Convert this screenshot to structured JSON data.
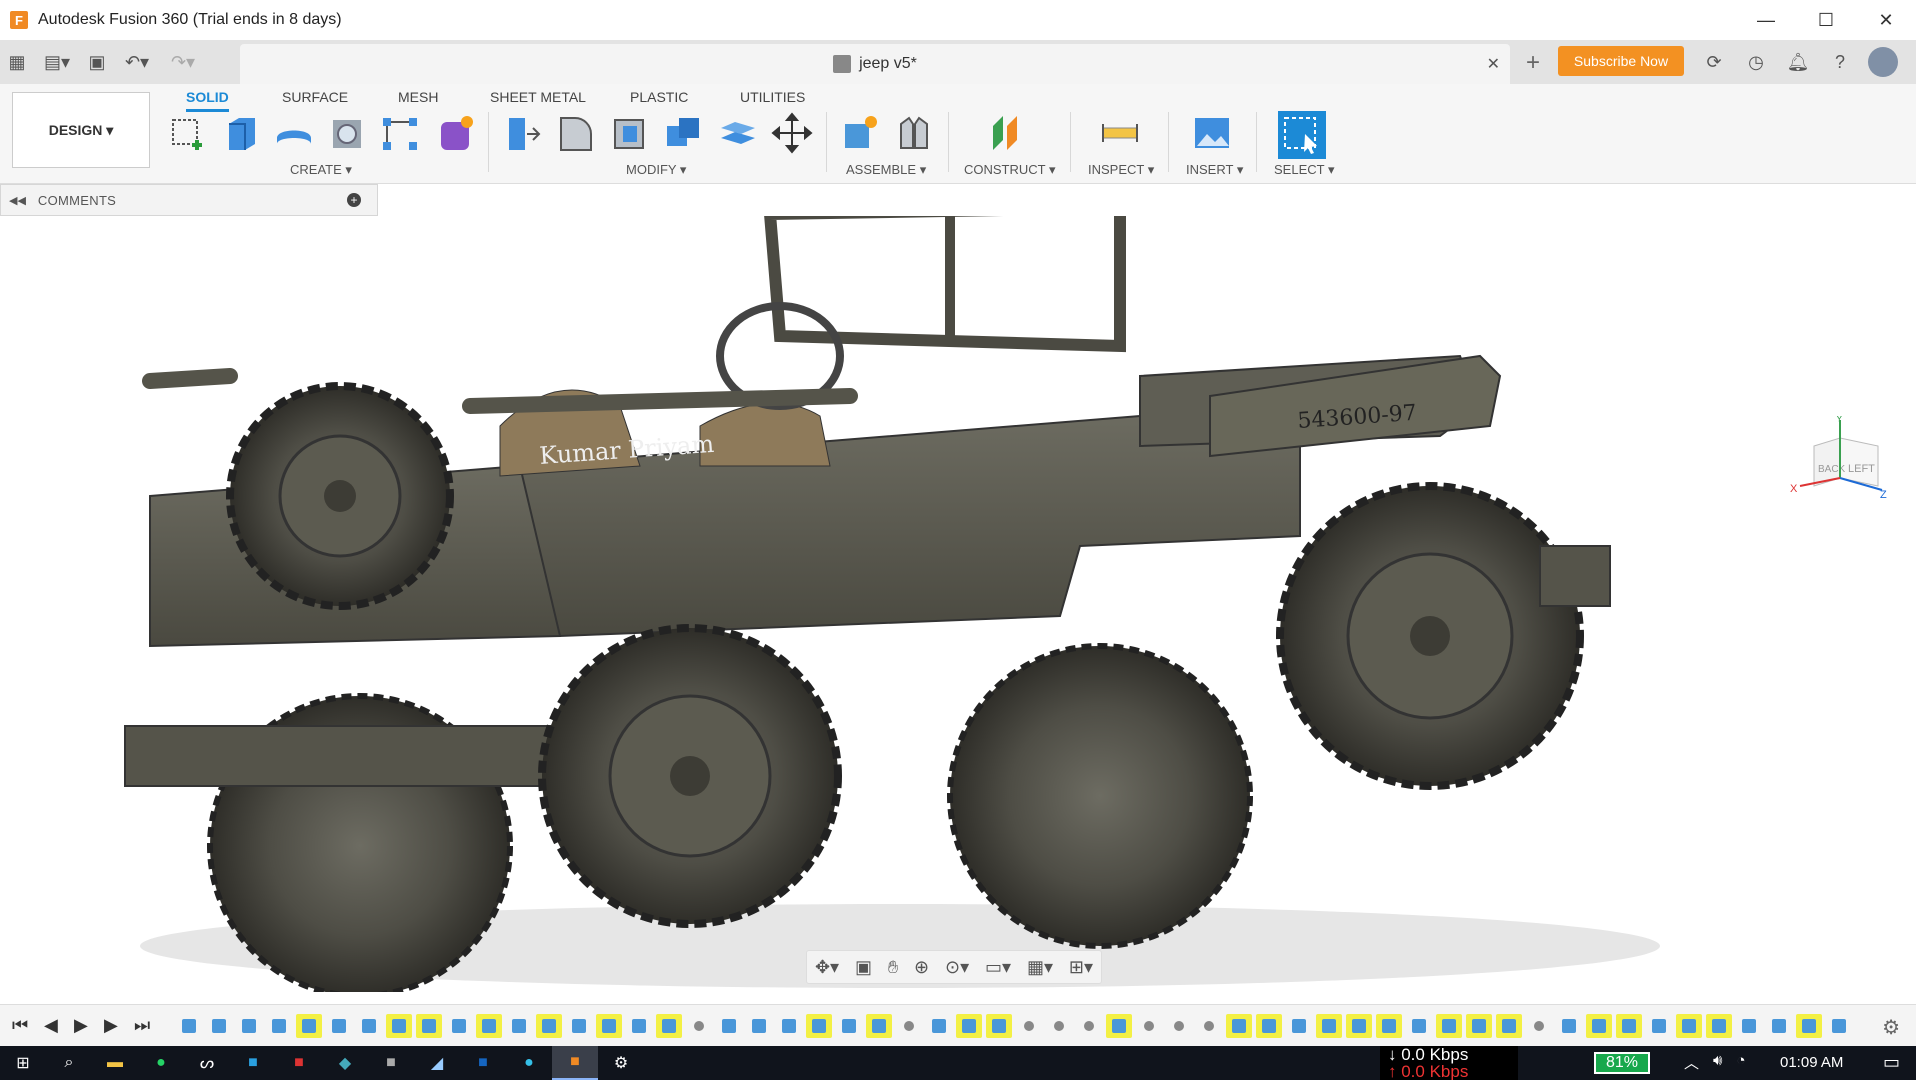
{
  "window": {
    "title": "Autodesk Fusion 360 (Trial ends in 8 days)",
    "app_icon": "F",
    "minimize": "—",
    "maximize": "☐",
    "close": "✕"
  },
  "tabbar": {
    "document_name": "jeep v5*",
    "close": "✕",
    "new_tab": "+",
    "subscribe_label": "Subscribe Now",
    "icons": [
      "apps-grid-icon",
      "file-icon",
      "save-icon",
      "undo-icon",
      "redo-icon",
      "refresh-icon",
      "clock-icon",
      "bell-icon",
      "help-icon",
      "avatar"
    ]
  },
  "ribbon": {
    "workspace": "DESIGN ▾",
    "tabs": [
      "SOLID",
      "SURFACE",
      "MESH",
      "SHEET METAL",
      "PLASTIC",
      "UTILITIES"
    ],
    "active_tab": "SOLID",
    "groups": [
      "CREATE ▾",
      "MODIFY ▾",
      "ASSEMBLE ▾",
      "CONSTRUCT ▾",
      "INSPECT ▾",
      "INSERT ▾",
      "SELECT ▾"
    ]
  },
  "browser": {
    "comments_label": "COMMENTS",
    "collapse": "◀◀"
  },
  "model": {
    "plate_text": "543600-97",
    "name_text": "Kumar Priyam"
  },
  "viewcube": {
    "back": "BACK",
    "left": "LEFT",
    "x": "X",
    "y": "Y",
    "z": "Z"
  },
  "timeline": {
    "controls": [
      "⏮",
      "◀",
      "▶",
      "▶",
      "⏭"
    ],
    "gear": "⚙"
  },
  "taskbar": {
    "net_down": "↓ 0.0 Kbps",
    "net_up": "↑ 0.0 Kbps",
    "battery": "81%",
    "time": "01:09 AM"
  },
  "colors": {
    "accent": "#1c8ad6",
    "subscribe": "#f39122",
    "sketch_highlight": "#f3f044",
    "model": "#5c5b50"
  }
}
